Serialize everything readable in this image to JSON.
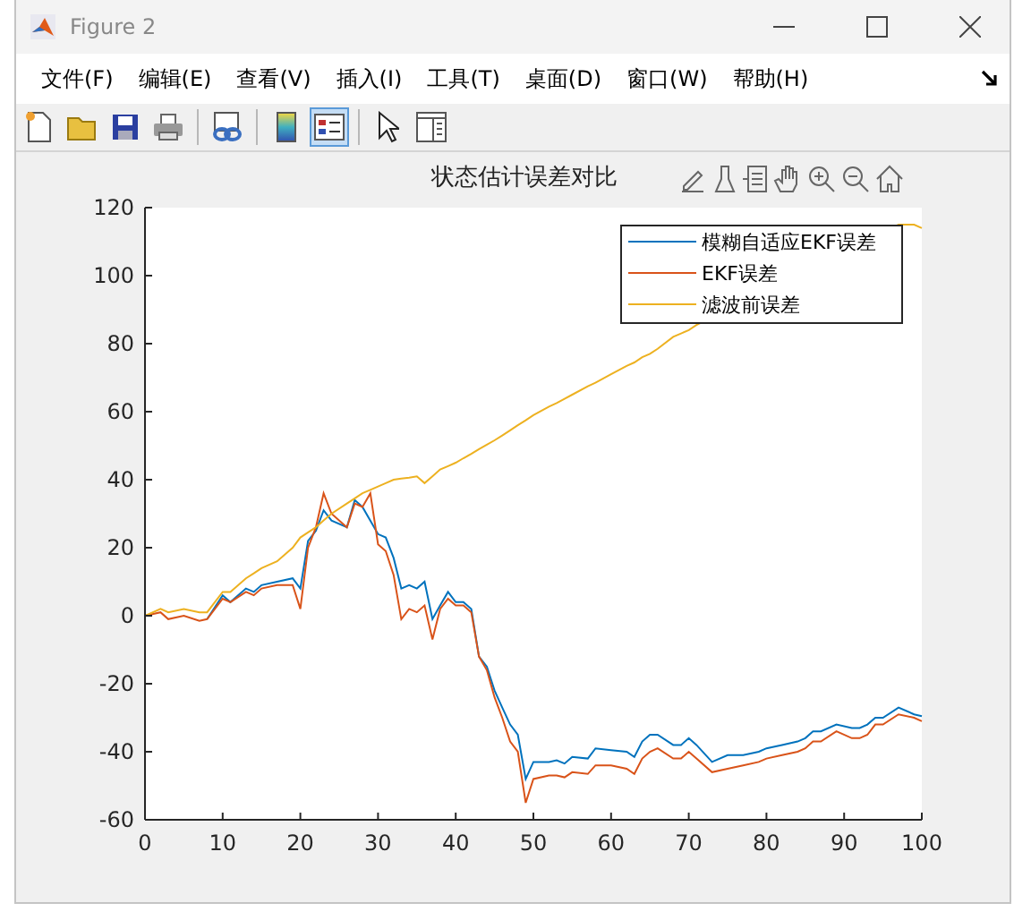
{
  "window": {
    "title": "Figure 2"
  },
  "menu": [
    "文件(F)",
    "编辑(E)",
    "查看(V)",
    "插入(I)",
    "工具(T)",
    "桌面(D)",
    "窗口(W)",
    "帮助(H)"
  ],
  "toolbar": [
    {
      "kind": "new",
      "selected": false
    },
    {
      "kind": "open",
      "selected": false
    },
    {
      "kind": "save",
      "selected": false
    },
    {
      "kind": "print",
      "selected": false
    },
    {
      "kind": "separator"
    },
    {
      "kind": "link",
      "selected": false
    },
    {
      "kind": "separator"
    },
    {
      "kind": "colorbar",
      "selected": false
    },
    {
      "kind": "legend",
      "selected": true
    },
    {
      "kind": "separator"
    },
    {
      "kind": "pointer",
      "selected": false
    },
    {
      "kind": "inspector",
      "selected": false
    }
  ],
  "figure": {
    "chart_data": {
      "type": "line",
      "title": "状态估计误差对比",
      "x": [
        0,
        2,
        3,
        5,
        7,
        8,
        10,
        11,
        13,
        14,
        15,
        17,
        19,
        20,
        21,
        22,
        23,
        24,
        26,
        27,
        28,
        29,
        30,
        31,
        32,
        33,
        34,
        35,
        36,
        37,
        38,
        39,
        40,
        41,
        42,
        43,
        44,
        45,
        46,
        47,
        48,
        49,
        50,
        52,
        53,
        54,
        55,
        57,
        58,
        60,
        62,
        63,
        64,
        65,
        66,
        68,
        69,
        70,
        71,
        73,
        75,
        77,
        79,
        80,
        82,
        84,
        85,
        86,
        87,
        89,
        91,
        92,
        93,
        94,
        95,
        97,
        99,
        100
      ],
      "series": [
        {
          "name": "模糊自适应EKF误差",
          "color": "#0072bd",
          "values": [
            null,
            null,
            null,
            null,
            null,
            -1,
            6,
            4,
            8,
            7,
            9,
            10,
            11,
            8,
            22,
            25,
            31,
            28,
            26,
            34,
            32,
            null,
            24,
            23,
            17,
            8,
            9,
            8,
            10,
            -1,
            3,
            7,
            4,
            4,
            2,
            -12,
            -15,
            -22,
            -27,
            -32,
            -35,
            -48,
            -43,
            -43,
            -42.5,
            -43.5,
            -41.5,
            -42,
            -39,
            -39.5,
            -40,
            -41.5,
            -37,
            -35,
            -35,
            -38,
            -38,
            -36,
            -38,
            -43,
            -41,
            -41,
            -40,
            -39,
            -38,
            -37,
            -36,
            -34,
            -34,
            -32,
            -33,
            -33,
            -32,
            -30,
            -30,
            -27,
            -29,
            -29.5
          ]
        },
        {
          "name": "EKF误差",
          "color": "#d95319",
          "values": [
            0,
            1,
            -1,
            0,
            -1.5,
            -1,
            5,
            4,
            7,
            6,
            8,
            9,
            9,
            2,
            20,
            26,
            36,
            30,
            26,
            33,
            32,
            36,
            21,
            19,
            12,
            -1,
            2,
            1,
            3,
            -7,
            2,
            5,
            3,
            3,
            1,
            -12,
            -16,
            -24,
            -30,
            -37,
            -40,
            -55,
            -48,
            -47,
            -47,
            -47.5,
            -46,
            -46.5,
            -44,
            -44,
            -45,
            -46.5,
            -42,
            -40,
            -39,
            -42,
            -42,
            -40,
            -42,
            -46,
            -45,
            -44,
            -43,
            -42,
            -41,
            -40,
            -39,
            -37,
            -37,
            -34,
            -36,
            -36,
            -35,
            -32,
            -32,
            -29,
            -30,
            -31
          ]
        },
        {
          "name": "滤波前误差",
          "color": "#edb120",
          "values": [
            0,
            2,
            1,
            2,
            1,
            1,
            7,
            7,
            11,
            12.5,
            14,
            16,
            20,
            23,
            24.5,
            26,
            28,
            30,
            33,
            34.5,
            36,
            37,
            38,
            39,
            40,
            40.3,
            40.6,
            41,
            39,
            41,
            43,
            44,
            45,
            46.3,
            47.6,
            49,
            50.3,
            51.6,
            53,
            54.5,
            56,
            57.5,
            59,
            61.5,
            62.5,
            63.8,
            65,
            67.5,
            68.5,
            71,
            73.5,
            74.5,
            76,
            77,
            78.5,
            82,
            83,
            84,
            85.5,
            null,
            null,
            null,
            null,
            null,
            null,
            null,
            null,
            null,
            null,
            null,
            null,
            null,
            null,
            null,
            null,
            115,
            115,
            114
          ]
        }
      ],
      "legend": true,
      "xlim": [
        0,
        100
      ],
      "ylim": [
        -60,
        120
      ],
      "xticks": [
        0,
        10,
        20,
        30,
        40,
        50,
        60,
        70,
        80,
        90,
        100
      ],
      "yticks": [
        -60,
        -40,
        -20,
        0,
        20,
        40,
        60,
        80,
        100,
        120
      ]
    }
  }
}
